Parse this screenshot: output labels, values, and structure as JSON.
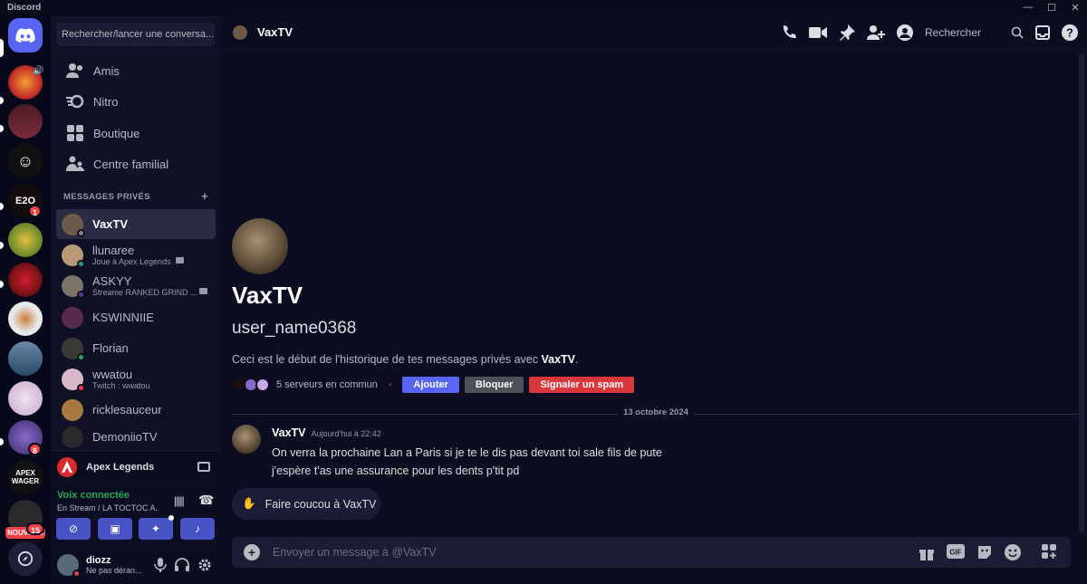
{
  "window": {
    "title": "Discord",
    "controls": [
      "minimize",
      "maximize",
      "close"
    ]
  },
  "servers": [
    {
      "name": "home",
      "icon": "discord-logo-icon",
      "active": true
    },
    {
      "name": "server-1",
      "color": "#c8312a",
      "speaker": true
    },
    {
      "name": "server-2",
      "color": "#4a1c24"
    },
    {
      "name": "server-3",
      "color": "#111111"
    },
    {
      "name": "server-4",
      "color": "#1a1010",
      "badge": "1"
    },
    {
      "name": "server-5",
      "color": "#6d8a2a"
    },
    {
      "name": "server-6",
      "color": "#7a1218"
    },
    {
      "name": "server-7",
      "color": "#e8e8e8"
    },
    {
      "name": "server-8",
      "color": "#2a4a6a"
    },
    {
      "name": "server-9",
      "color": "#d8c8d8"
    },
    {
      "name": "server-10",
      "color": "#3a2a6a",
      "badge": "8"
    },
    {
      "name": "server-11",
      "color": "#111111"
    },
    {
      "name": "server-12",
      "color": "#2a2a2a",
      "tag": "NOUVEAU",
      "badge": "15"
    }
  ],
  "sidebar": {
    "search_placeholder": "Rechercher/lancer une conversa...",
    "nav": [
      {
        "label": "Amis",
        "icon": "friends-icon"
      },
      {
        "label": "Nitro",
        "icon": "nitro-icon"
      },
      {
        "label": "Boutique",
        "icon": "shop-icon"
      },
      {
        "label": "Centre familial",
        "icon": "family-icon"
      }
    ],
    "dm_header": "MESSAGES PRIVÉS",
    "dms": [
      {
        "name": "VaxTV",
        "sub": "",
        "status": "offline",
        "color": "#6b5a4a",
        "active": true
      },
      {
        "name": "llunaree",
        "sub": "Joue à Apex Legends",
        "status": "online",
        "color": "#b89878"
      },
      {
        "name": "ASKYY",
        "sub": "Streame RANKED GRIND ...",
        "status": "streaming",
        "color": "#7a7468"
      },
      {
        "name": "KSWINNIIE",
        "sub": "",
        "status": "",
        "color": "#5a2a4a"
      },
      {
        "name": "Florian",
        "sub": "",
        "status": "online",
        "color": "#3a3a3a"
      },
      {
        "name": "wwatou",
        "sub": "Twitch : wwatou",
        "status": "dnd",
        "color": "#d8b8c8"
      },
      {
        "name": "ricklesauceur",
        "sub": "",
        "status": "",
        "color": "#a87840"
      },
      {
        "name": "DemoniioTV",
        "sub": "",
        "status": "",
        "color": "#2a2a2a"
      }
    ],
    "game": {
      "name": "Apex Legends"
    },
    "voice": {
      "status": "Voix connectée",
      "channel": "En Stream / LA TOCTOC A..."
    },
    "user": {
      "name": "diozz",
      "status": "Ne pas déran..."
    }
  },
  "header": {
    "name": "VaxTV",
    "search": "Rechercher"
  },
  "intro": {
    "name": "VaxTV",
    "username": "user_name0368",
    "desc_prefix": "Ceci est le début de l'historique de tes messages privés avec ",
    "desc_name": "VaxTV",
    "desc_suffix": ".",
    "common": "5 serveurs en commun",
    "btn_add": "Ajouter",
    "btn_block": "Bloquer",
    "btn_spam": "Signaler un spam"
  },
  "date_divider": "13 octobre 2024",
  "message": {
    "author": "VaxTV",
    "time": "Aujourd'hui à 22:42",
    "lines": [
      "On verra la prochaine Lan a Paris si je te le dis pas devant toi sale fils de pute",
      "j'espère t'as une assurance pour les dents p'tit pd"
    ]
  },
  "wave_button": "Faire coucou à VaxTV",
  "composer": {
    "placeholder": "Envoyer un message à @VaxTV"
  },
  "colors": {
    "accent": "#5865f2",
    "danger": "#da373c",
    "online": "#23a55a",
    "secondary_btn": "#4e5058"
  }
}
